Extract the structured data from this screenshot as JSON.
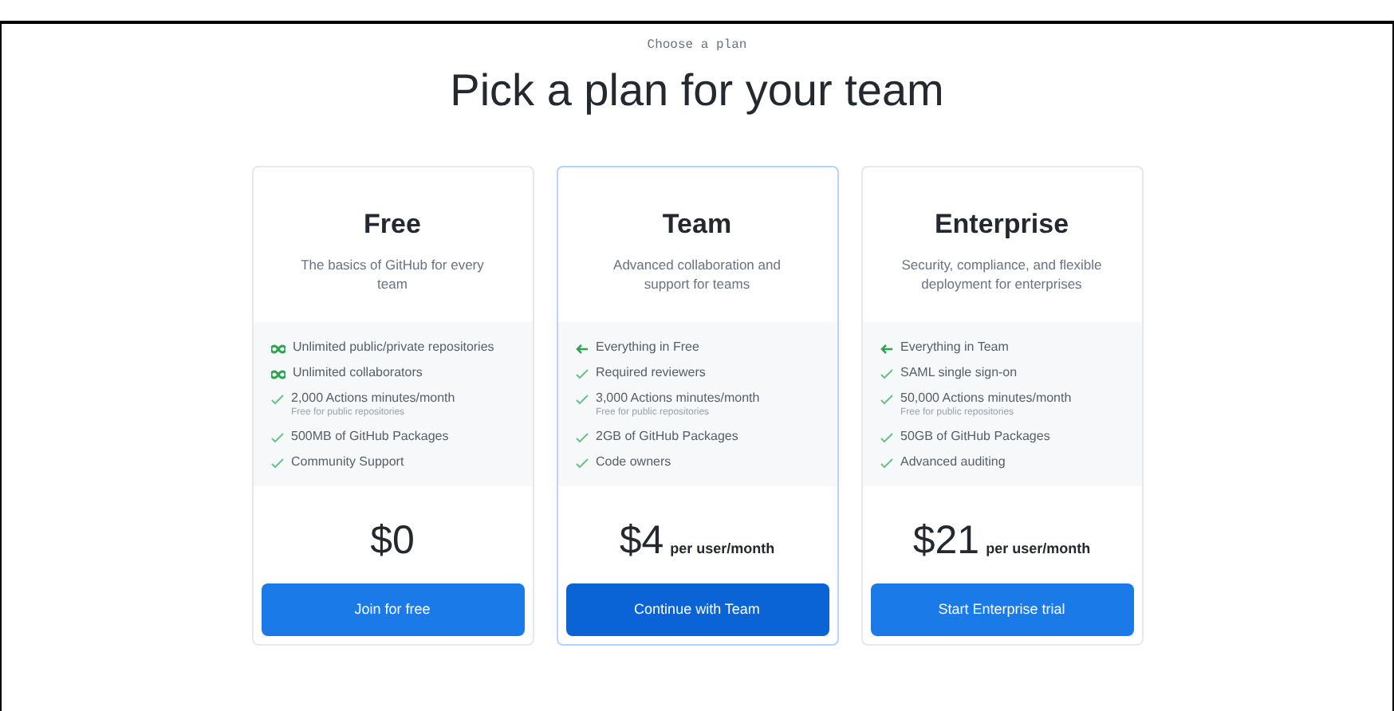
{
  "eyebrow": "Choose a plan",
  "title": "Pick a plan for your team",
  "plans": [
    {
      "name": "Free",
      "description": "The basics of GitHub for every team",
      "selected": false,
      "price": "$0",
      "button": "Join for free",
      "features": [
        {
          "kind": "infinity",
          "text": "Unlimited public/private repositories"
        },
        {
          "kind": "infinity",
          "text": "Unlimited collaborators"
        },
        {
          "kind": "check",
          "text": "2,000 Actions minutes/month",
          "note": "Free for public repositories"
        },
        {
          "kind": "check",
          "text": "500MB of GitHub Packages"
        },
        {
          "kind": "check",
          "text": "Community Support"
        }
      ]
    },
    {
      "name": "Team",
      "description": "Advanced collaboration and support for teams",
      "selected": true,
      "price": "$4",
      "unit": "per user/month",
      "button": "Continue with Team",
      "features": [
        {
          "kind": "arrow",
          "text": "Everything in Free"
        },
        {
          "kind": "check",
          "text": "Required reviewers"
        },
        {
          "kind": "check",
          "text": "3,000 Actions minutes/month",
          "note": "Free for public repositories"
        },
        {
          "kind": "check",
          "text": "2GB of GitHub Packages"
        },
        {
          "kind": "check",
          "text": "Code owners"
        }
      ]
    },
    {
      "name": "Enterprise",
      "description": "Security, compliance, and flexible deployment for enterprises",
      "selected": false,
      "price": "$21",
      "unit": "per user/month",
      "button": "Start Enterprise trial",
      "features": [
        {
          "kind": "arrow",
          "text": "Everything in Team"
        },
        {
          "kind": "check",
          "text": "SAML single sign-on"
        },
        {
          "kind": "check",
          "text": "50,000 Actions minutes/month",
          "note": "Free for public repositories"
        },
        {
          "kind": "check",
          "text": "50GB of GitHub Packages"
        },
        {
          "kind": "check",
          "text": "Advanced auditing"
        }
      ]
    }
  ]
}
